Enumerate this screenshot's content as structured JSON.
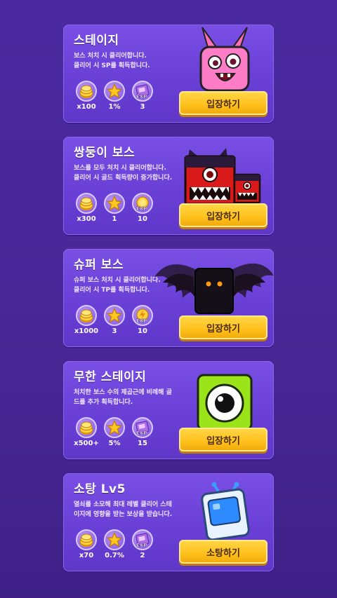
{
  "cards": [
    {
      "title": "스테이지",
      "desc": [
        "보스 처치 시 클리어합니다.",
        "클리어 시 SP를 획득합니다."
      ],
      "rewards": [
        {
          "icon": "gold-coins-icon",
          "value": "x100"
        },
        {
          "icon": "star-icon",
          "value": "1%"
        },
        {
          "icon": "exp-book-icon",
          "value": "3"
        }
      ],
      "button": "입장하기"
    },
    {
      "title": "쌍둥이 보스",
      "desc": [
        "보스를 모두 처치 시 클리어합니다.",
        "클리어 시 골드 획득량이 증가합니다."
      ],
      "rewards": [
        {
          "icon": "gold-coins-icon",
          "value": "x300"
        },
        {
          "icon": "star-icon",
          "value": "1"
        },
        {
          "icon": "exp-coin-icon",
          "value": "10"
        }
      ],
      "button": "입장하기"
    },
    {
      "title": "슈퍼 보스",
      "desc": [
        "슈퍼 보스 처치 시 클리어합니다.",
        "클리어 시 TP를 획득합니다."
      ],
      "rewards": [
        {
          "icon": "gold-coins-icon",
          "value": "x1000"
        },
        {
          "icon": "star-icon",
          "value": "3"
        },
        {
          "icon": "exp-bolt-icon",
          "value": "10"
        }
      ],
      "button": "입장하기"
    },
    {
      "title": "무한 스테이지",
      "desc": [
        "처치한 보스 수의 제곱근에 비례해 골",
        "드를 추가 획득합니다."
      ],
      "rewards": [
        {
          "icon": "gold-coins-icon",
          "value": "x500+"
        },
        {
          "icon": "star-icon",
          "value": "5%"
        },
        {
          "icon": "exp-book-icon",
          "value": "15"
        }
      ],
      "button": "입장하기"
    },
    {
      "title": "소탕 Lv5",
      "desc": [
        "열쇠를 소모해 최대 레벨 클리어 스테",
        "이지에 영향을 받는 보상을 받습니다."
      ],
      "rewards": [
        {
          "icon": "gold-coins-icon",
          "value": "x70"
        },
        {
          "icon": "star-icon",
          "value": "0.7%"
        },
        {
          "icon": "exp-book-icon",
          "value": "2"
        }
      ],
      "button": "소탕하기"
    }
  ],
  "colors": {
    "background": "#4a2797",
    "card": "#6a3fd6",
    "button": "#ffc21e",
    "button_text": "#4a2a08"
  }
}
